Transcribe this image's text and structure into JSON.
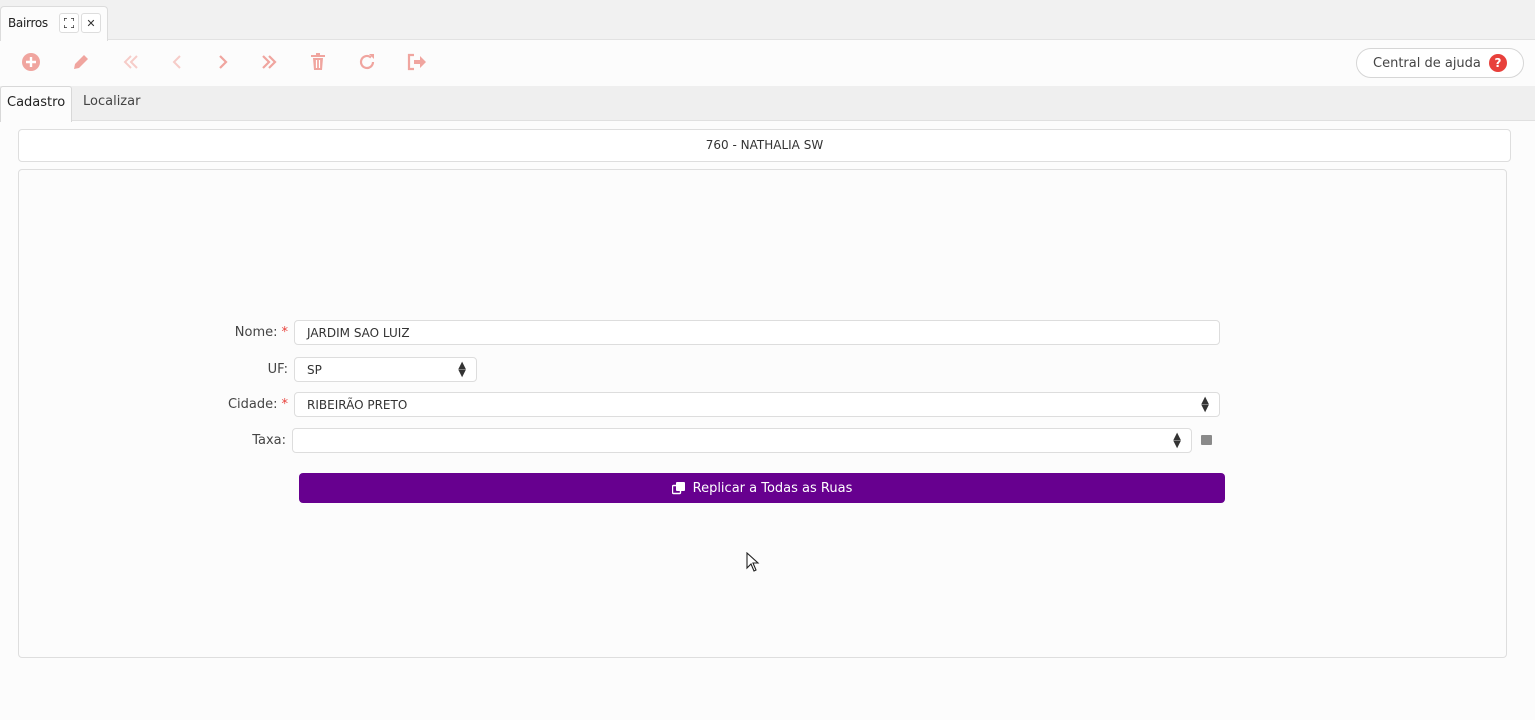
{
  "window_tab": {
    "title": "Bairros"
  },
  "toolbar": {
    "items": [
      "add-icon",
      "edit-icon",
      "first-record-icon",
      "previous-record-icon",
      "next-record-icon",
      "last-record-icon",
      "delete-icon",
      "refresh-icon",
      "exit-icon"
    ],
    "accent": "#f0a59f",
    "help_label": "Central de ajuda",
    "help_glyph": "?"
  },
  "tabs": [
    {
      "label": "Cadastro",
      "active": true
    },
    {
      "label": "Localizar",
      "active": false
    }
  ],
  "record_header": "760 - NATHALIA SW",
  "form": {
    "nome": {
      "label": "Nome:",
      "required_mark": "*",
      "value": "JARDIM SAO LUIZ"
    },
    "uf": {
      "label": "UF:",
      "value": "SP"
    },
    "cidade": {
      "label": "Cidade:",
      "required_mark": "*",
      "value": "RIBEIRÃO PRETO"
    },
    "taxa": {
      "label": "Taxa:",
      "value": ""
    }
  },
  "replicate_button": {
    "label": "Replicar a Todas as Ruas",
    "color": "#67008f"
  }
}
